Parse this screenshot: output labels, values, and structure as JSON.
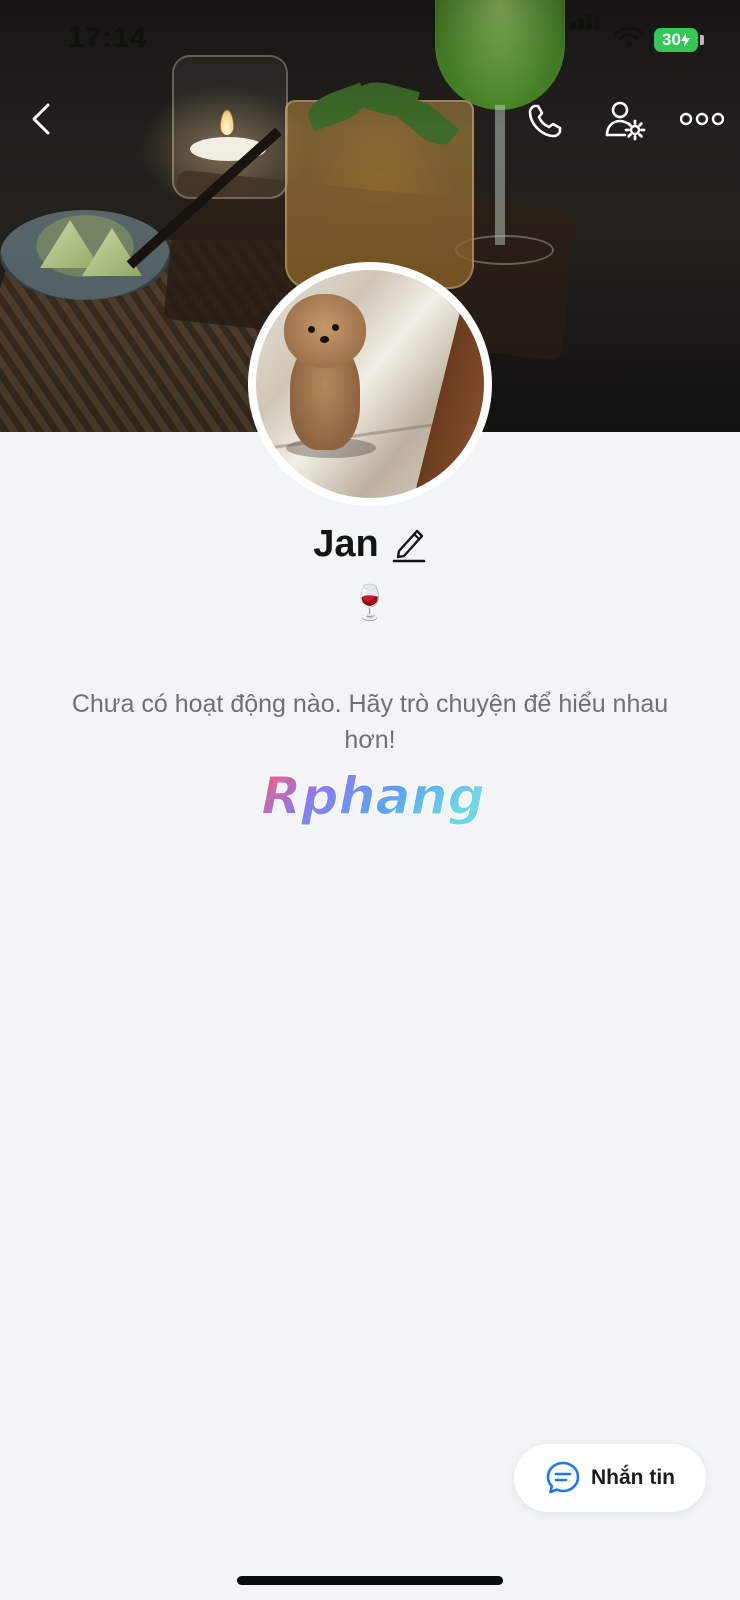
{
  "status_bar": {
    "time": "17:14",
    "battery_level": "30",
    "battery_color": "#35c759"
  },
  "nav": {
    "back_icon": "chevron-left-icon",
    "call_icon": "phone-icon",
    "settings_icon": "user-settings-icon",
    "more_icon": "more-dots-icon"
  },
  "profile": {
    "name": "Jan",
    "bio": "🍷",
    "edit_icon": "pencil-icon"
  },
  "activity": {
    "empty_message": "Chưa có hoạt động nào. Hãy trò chuyện để hiểu nhau hơn!"
  },
  "watermark": {
    "text": "Rphang"
  },
  "message_button": {
    "label": "Nhắn tin",
    "icon": "chat-bubble-icon",
    "accent": "#1877f2"
  }
}
